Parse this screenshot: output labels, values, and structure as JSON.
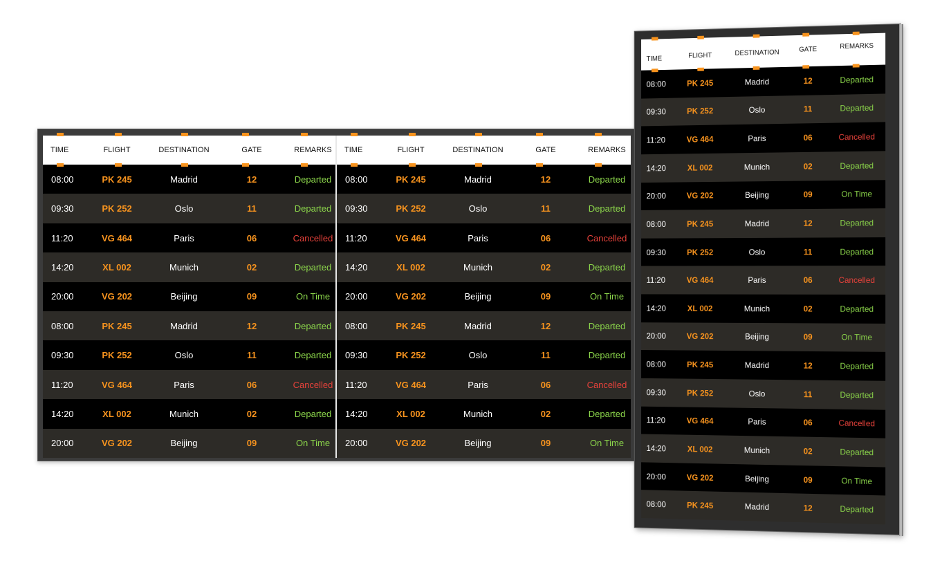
{
  "columns": {
    "time": "TIME",
    "flight": "FLIGHT",
    "destination": "DESTINATION",
    "gate": "GATE",
    "remarks": "REMARKS"
  },
  "colors": {
    "accent": "#f7931e",
    "departed": "#8cd64b",
    "on_time": "#8cd64b",
    "cancelled": "#e8423b",
    "row_alt": "#2d2b27",
    "row_dark": "#000000"
  },
  "flights": [
    {
      "time": "08:00",
      "flight": "PK 245",
      "destination": "Madrid",
      "gate": "12",
      "remarks": "Departed",
      "status": "departed"
    },
    {
      "time": "09:30",
      "flight": "PK 252",
      "destination": "Oslo",
      "gate": "11",
      "remarks": "Departed",
      "status": "departed"
    },
    {
      "time": "11:20",
      "flight": "VG 464",
      "destination": "Paris",
      "gate": "06",
      "remarks": "Cancelled",
      "status": "cancelled"
    },
    {
      "time": "14:20",
      "flight": "XL 002",
      "destination": "Munich",
      "gate": "02",
      "remarks": "Departed",
      "status": "departed"
    },
    {
      "time": "20:00",
      "flight": "VG 202",
      "destination": "Beijing",
      "gate": "09",
      "remarks": "On Time",
      "status": "ontime"
    },
    {
      "time": "08:00",
      "flight": "PK 245",
      "destination": "Madrid",
      "gate": "12",
      "remarks": "Departed",
      "status": "departed"
    },
    {
      "time": "09:30",
      "flight": "PK 252",
      "destination": "Oslo",
      "gate": "11",
      "remarks": "Departed",
      "status": "departed"
    },
    {
      "time": "11:20",
      "flight": "VG 464",
      "destination": "Paris",
      "gate": "06",
      "remarks": "Cancelled",
      "status": "cancelled"
    },
    {
      "time": "14:20",
      "flight": "XL 002",
      "destination": "Munich",
      "gate": "02",
      "remarks": "Departed",
      "status": "departed"
    },
    {
      "time": "20:00",
      "flight": "VG 202",
      "destination": "Beijing",
      "gate": "09",
      "remarks": "On Time",
      "status": "ontime"
    }
  ],
  "portrait_flights": [
    {
      "time": "08:00",
      "flight": "PK 245",
      "destination": "Madrid",
      "gate": "12",
      "remarks": "Departed",
      "status": "departed"
    },
    {
      "time": "09:30",
      "flight": "PK 252",
      "destination": "Oslo",
      "gate": "11",
      "remarks": "Departed",
      "status": "departed"
    },
    {
      "time": "11:20",
      "flight": "VG 464",
      "destination": "Paris",
      "gate": "06",
      "remarks": "Cancelled",
      "status": "cancelled"
    },
    {
      "time": "14:20",
      "flight": "XL 002",
      "destination": "Munich",
      "gate": "02",
      "remarks": "Departed",
      "status": "departed"
    },
    {
      "time": "20:00",
      "flight": "VG 202",
      "destination": "Beijing",
      "gate": "09",
      "remarks": "On Time",
      "status": "ontime"
    },
    {
      "time": "08:00",
      "flight": "PK 245",
      "destination": "Madrid",
      "gate": "12",
      "remarks": "Departed",
      "status": "departed"
    },
    {
      "time": "09:30",
      "flight": "PK 252",
      "destination": "Oslo",
      "gate": "11",
      "remarks": "Departed",
      "status": "departed"
    },
    {
      "time": "11:20",
      "flight": "VG 464",
      "destination": "Paris",
      "gate": "06",
      "remarks": "Cancelled",
      "status": "cancelled"
    },
    {
      "time": "14:20",
      "flight": "XL 002",
      "destination": "Munich",
      "gate": "02",
      "remarks": "Departed",
      "status": "departed"
    },
    {
      "time": "20:00",
      "flight": "VG 202",
      "destination": "Beijing",
      "gate": "09",
      "remarks": "On Time",
      "status": "ontime"
    },
    {
      "time": "08:00",
      "flight": "PK 245",
      "destination": "Madrid",
      "gate": "12",
      "remarks": "Departed",
      "status": "departed"
    },
    {
      "time": "09:30",
      "flight": "PK 252",
      "destination": "Oslo",
      "gate": "11",
      "remarks": "Departed",
      "status": "departed"
    },
    {
      "time": "11:20",
      "flight": "VG 464",
      "destination": "Paris",
      "gate": "06",
      "remarks": "Cancelled",
      "status": "cancelled"
    },
    {
      "time": "14:20",
      "flight": "XL 002",
      "destination": "Munich",
      "gate": "02",
      "remarks": "Departed",
      "status": "departed"
    },
    {
      "time": "20:00",
      "flight": "VG 202",
      "destination": "Beijing",
      "gate": "09",
      "remarks": "On Time",
      "status": "ontime"
    },
    {
      "time": "08:00",
      "flight": "PK 245",
      "destination": "Madrid",
      "gate": "12",
      "remarks": "Departed",
      "status": "departed"
    }
  ]
}
